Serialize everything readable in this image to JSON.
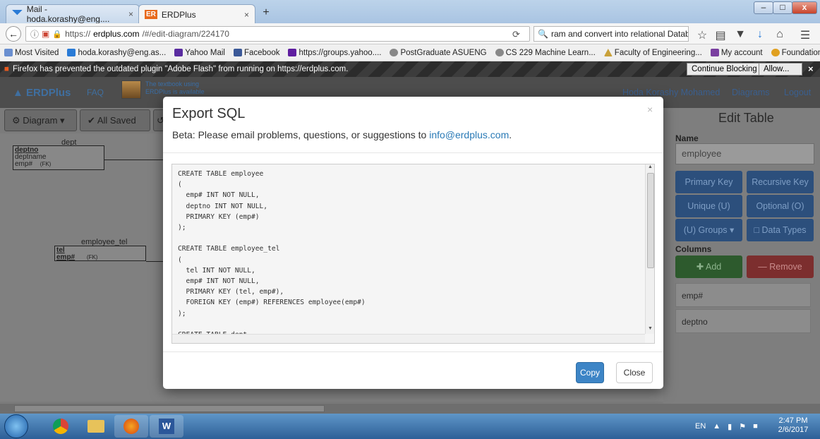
{
  "browser": {
    "tabs": [
      {
        "label": "Mail - hoda.korashy@eng....",
        "close": "×"
      },
      {
        "label": "ERDPlus",
        "close": "×"
      }
    ],
    "new_tab": "+",
    "window_controls": {
      "minimize": "–",
      "maximize": "□",
      "close": "x"
    },
    "url_prefix": "https://",
    "url_domain": "erdplus.com",
    "url_path": "/#/edit-diagram/224170",
    "search_text": "ram and convert into relational Database",
    "bookmarks": [
      "Most Visited",
      "hoda.korashy@eng.as...",
      "Yahoo Mail",
      "Facebook",
      "https://groups.yahoo....",
      "PostGraduate ASUENG",
      "CS 229 Machine Learn...",
      "Faculty of Engineering...",
      "My account",
      "Foundations of Progra..."
    ],
    "bookmarks_more": "»",
    "notification": "Firefox has prevented the outdated plugin \"Adobe Flash\" from running on https://erdplus.com.",
    "continue_blocking": "Continue Blocking",
    "allow": "Allow...",
    "notif_close": "×"
  },
  "app": {
    "brand": "ERDPlus",
    "faq": "FAQ",
    "textbook_promo": "The textbook using ERDPlus is available",
    "user": "Hoda Korashy Mohamed",
    "diagrams": "Diagrams",
    "logout": "Logout",
    "toolbar": {
      "diagram": "Diagram",
      "saved": "All Saved"
    },
    "tables": [
      {
        "title": "dept",
        "rows": [
          {
            "name": "deptno",
            "fk": ""
          },
          {
            "name": "deptname",
            "fk": ""
          },
          {
            "name": "emp#",
            "fk": "(FK)"
          }
        ]
      },
      {
        "title": "employee_tel",
        "rows": [
          {
            "name": "tel",
            "fk": ""
          },
          {
            "name": "emp#",
            "fk": "(FK)"
          }
        ]
      }
    ],
    "edit_table": {
      "title": "Edit Table",
      "name_label": "Name",
      "name_value": "employee",
      "buttons": [
        "Primary Key",
        "Recursive Key",
        "Unique (U)",
        "Optional (O)",
        "(U) Groups ▾",
        "Data Types"
      ],
      "columns_label": "Columns",
      "add": "Add",
      "remove": "Remove",
      "columns": [
        "emp#",
        "deptno"
      ]
    }
  },
  "modal": {
    "title": "Export SQL",
    "subtitle_prefix": "Beta: Please email problems, questions, or suggestions to ",
    "email": "info@erdplus.com",
    "subtitle_suffix": ".",
    "close_x": "×",
    "sql": "CREATE TABLE employee\n(\n  emp# INT NOT NULL,\n  deptno INT NOT NULL,\n  PRIMARY KEY (emp#)\n);\n\nCREATE TABLE employee_tel\n(\n  tel INT NOT NULL,\n  emp# INT NOT NULL,\n  PRIMARY KEY (tel, emp#),\n  FOREIGN KEY (emp#) REFERENCES employee(emp#)\n);\n\nCREATE TABLE dept",
    "copy": "Copy",
    "close": "Close"
  },
  "taskbar": {
    "lang": "EN",
    "time": "2:47 PM",
    "date": "2/6/2017"
  }
}
